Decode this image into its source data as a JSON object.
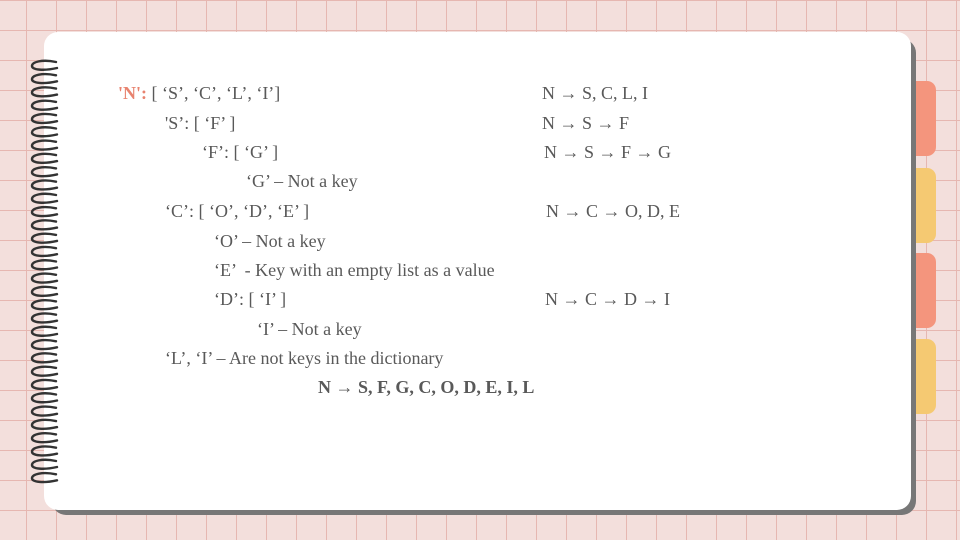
{
  "colors": {
    "background": "#f3dfdc",
    "grid": "#e6b7b1",
    "tab_coral": "#f4957d",
    "tab_yellow": "#f5c972",
    "text": "#595959",
    "accent": "#e8836f"
  },
  "tabs": [
    {
      "color": "#f4957d"
    },
    {
      "color": "#f5c972"
    },
    {
      "color": "#f4957d"
    },
    {
      "color": "#f5c972"
    }
  ],
  "lines": {
    "n_key": "'N':",
    "n_list": " [ ‘S’, ‘C’, ‘L’, ‘I’]",
    "s_line": "'S’: [ ‘F’ ]",
    "f_line": "‘F’: [ ‘G’ ]",
    "g_line": "‘G’ – Not a key",
    "c_line": "‘C’: [ ‘O’, ‘D’, ‘E’ ]",
    "o_line": "‘O’ – Not a key",
    "e_line": "‘E’  - Key with an empty list as a value",
    "d_line": "‘D’: [ ‘I’ ]",
    "i_line": "‘I’ – Not a key",
    "li_line": "‘L’, ‘I’ – Are not keys in the dictionary"
  },
  "paths": {
    "p1": "N → S, C, L, I",
    "p2": "N → S → F",
    "p3": "N → S → F → G",
    "p4": "N → C → O, D, E",
    "p5": "N → C → D → I"
  },
  "result": "N → S, F, G, C, O, D, E, I, L"
}
